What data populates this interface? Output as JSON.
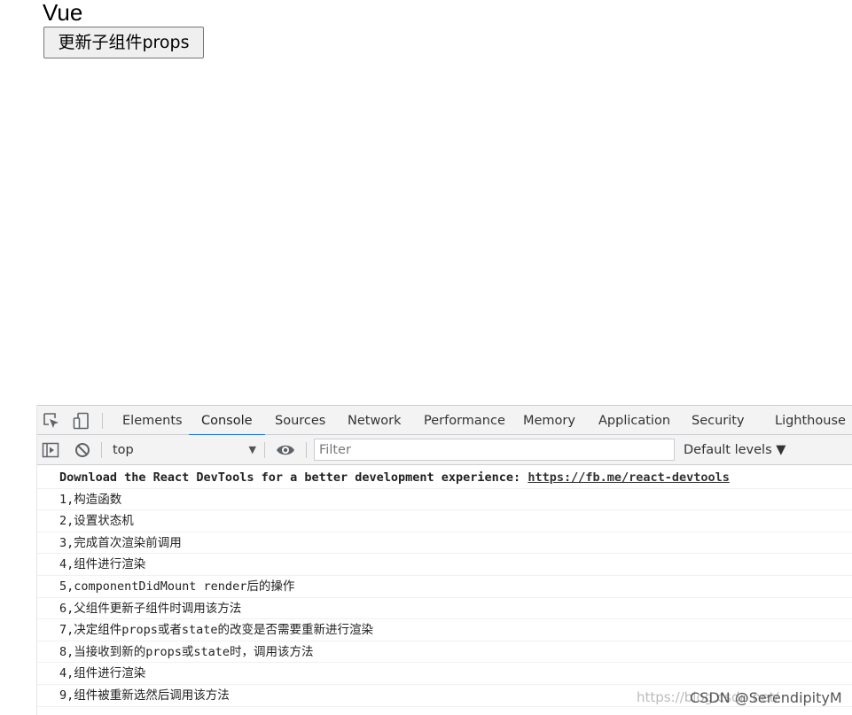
{
  "page": {
    "heading": "Vue",
    "button_label": "更新子组件props"
  },
  "devtools": {
    "tabs": [
      {
        "label": "Elements"
      },
      {
        "label": "Console"
      },
      {
        "label": "Sources"
      },
      {
        "label": "Network"
      },
      {
        "label": "Performance"
      },
      {
        "label": "Memory"
      },
      {
        "label": "Application"
      },
      {
        "label": "Security"
      },
      {
        "label": "Lighthouse"
      }
    ],
    "active_tab": "Console",
    "accent_color": "#1a73e8",
    "toolbar": {
      "context": "top",
      "filter_placeholder": "Filter",
      "levels": "Default levels ▼"
    },
    "console": {
      "intro_text": "Download the React DevTools for a better development experience: ",
      "intro_link": "https://fb.me/react-devtools",
      "logs": [
        "1,构造函数",
        "2,设置状态机",
        "3,完成首次渲染前调用",
        "4,组件进行渲染",
        "5,componentDidMount render后的操作",
        "6,父组件更新子组件时调用该方法",
        "7,决定组件props或者state的改变是否需要重新进行渲染",
        "8,当接收到新的props或state时，调用该方法",
        "4,组件进行渲染",
        "9,组件被重新选然后调用该方法"
      ]
    }
  },
  "watermark": {
    "url_text": "https://blog.csdn.net/",
    "brand_text": "CSDN @SerendipityM"
  }
}
